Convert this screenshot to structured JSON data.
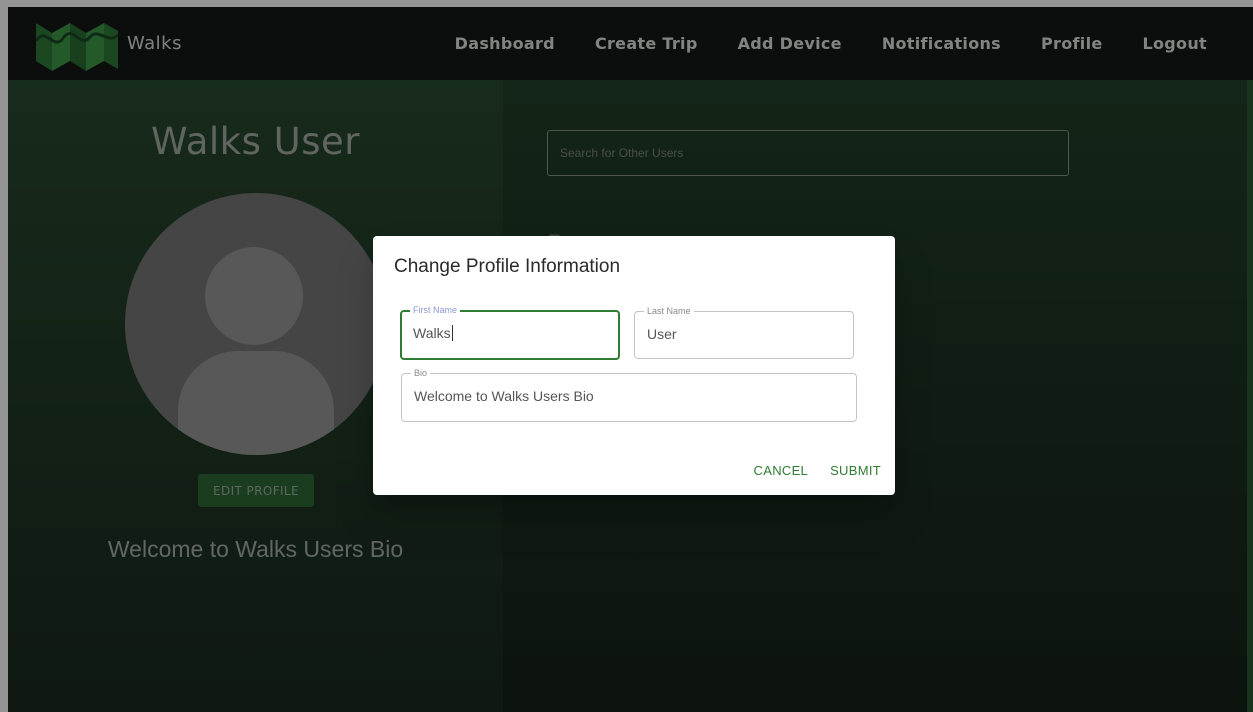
{
  "navbar": {
    "brand": "Walks",
    "links": [
      "Dashboard",
      "Create Trip",
      "Add Device",
      "Notifications",
      "Profile",
      "Logout"
    ]
  },
  "profile": {
    "name": "Walks User",
    "edit_label": "EDIT PROFILE",
    "bio": "Welcome to Walks Users Bio"
  },
  "search": {
    "placeholder": "Search for Other Users"
  },
  "friends": {
    "heading": "F..."
  },
  "dialog": {
    "title": "Change Profile Information",
    "first_name_label": "First Name",
    "first_name_value": "Walks",
    "last_name_label": "Last Name",
    "last_name_value": "User",
    "bio_label": "Bio",
    "bio_value": "Welcome to Walks Users Bio",
    "cancel_label": "CANCEL",
    "submit_label": "SUBMIT"
  },
  "colors": {
    "accent": "#2e7d32",
    "nav_bg": "#151917",
    "page_bg": "#1b2a1f",
    "focus_label": "#8a9ad6"
  },
  "icons": {
    "logo": "walks-logo-icon",
    "avatar": "default-avatar-icon"
  }
}
